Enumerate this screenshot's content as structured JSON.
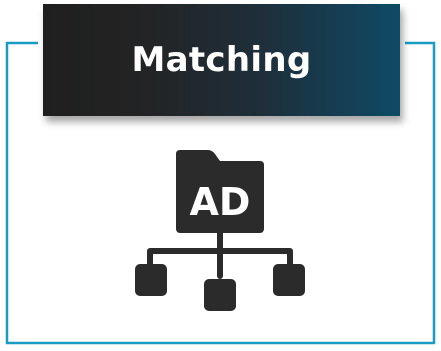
{
  "title": "Matching",
  "icon": {
    "name": "ad-folder-hierarchy-icon",
    "folder_text": "AD"
  },
  "colors": {
    "frame": "#1a9bc4",
    "title_bg_left": "#1f1f1f",
    "title_bg_right": "#0e4a66",
    "title_text": "#ffffff",
    "icon": "#2b2b2b"
  }
}
